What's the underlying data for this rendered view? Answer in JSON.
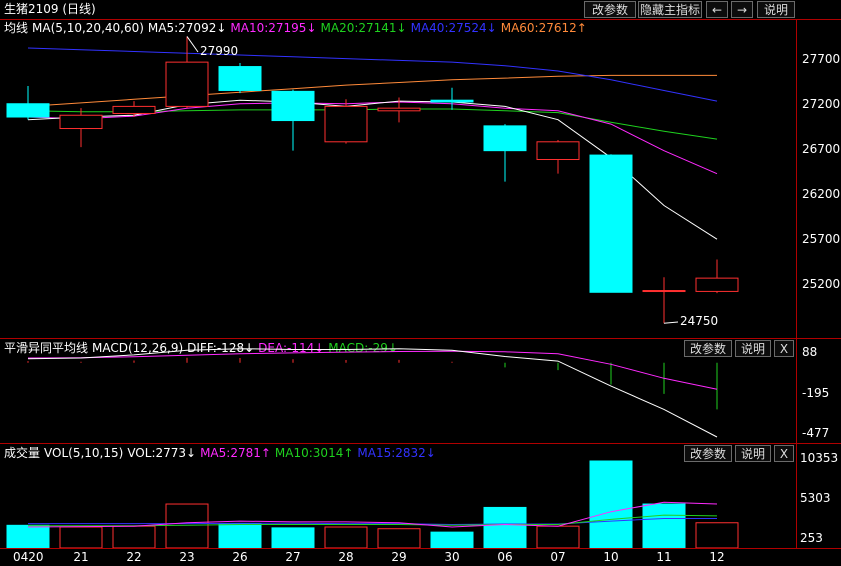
{
  "title": "生猪2109 (日线)",
  "toolbar": {
    "change_params": "改参数",
    "hide_indicator": "隐藏主指标",
    "left_arrow": "←",
    "right_arrow": "→",
    "help": "说明"
  },
  "ma_header": {
    "name": "均线",
    "ma": "MA(5,10,20,40,60)",
    "ma5": "MA5:27092↓",
    "ma10": "MA10:27195↓",
    "ma20": "MA20:27141↓",
    "ma40": "MA40:27524↓",
    "ma60": "MA60:27612↑"
  },
  "price_axis": [
    "27700",
    "27200",
    "26700",
    "26200",
    "25700",
    "25200"
  ],
  "annotations": {
    "high": "27990",
    "low": "24750"
  },
  "macd_header": {
    "name": "平滑异同平均线",
    "macd": "MACD(12,26,9)",
    "diff": "DIFF:-128↓",
    "dea": "DEA:-114↓",
    "value": "MACD:-29↓"
  },
  "macd_axis": [
    "88",
    "-195",
    "-477"
  ],
  "macd_buttons": {
    "change_params": "改参数",
    "help": "说明",
    "close": "X"
  },
  "vol_header": {
    "name": "成交量",
    "vol": "VOL(5,10,15)",
    "current": "VOL:2773↓",
    "ma5": "MA5:2781↑",
    "ma10": "MA10:3014↑",
    "ma15": "MA15:2832↓"
  },
  "vol_axis": [
    "10353",
    "5303",
    "253"
  ],
  "vol_buttons": {
    "change_params": "改参数",
    "help": "说明",
    "close": "X"
  },
  "dates": [
    "0420",
    "21",
    "22",
    "23",
    "26",
    "27",
    "28",
    "29",
    "30",
    "06",
    "07",
    "10",
    "11",
    "12"
  ],
  "colors": {
    "up": "#ff3030",
    "down": "#00ffff",
    "ma5": "#ffffff",
    "ma10": "#ff2aff",
    "ma20": "#1fd11f",
    "ma40": "#3232ff",
    "ma60": "#ff8a3a",
    "border": "#b00000"
  },
  "chart_data": {
    "type": "candlestick",
    "x": [
      "0420",
      "21",
      "22",
      "23",
      "26",
      "27",
      "28",
      "29",
      "30",
      "06",
      "07",
      "10",
      "11",
      "12"
    ],
    "candles": [
      {
        "open": 27230,
        "close": 27080,
        "high": 27430,
        "low": 27050
      },
      {
        "open": 26950,
        "close": 27100,
        "high": 27180,
        "low": 26740
      },
      {
        "open": 27120,
        "close": 27200,
        "high": 27260,
        "low": 27080
      },
      {
        "open": 27200,
        "close": 27700,
        "high": 27990,
        "low": 27180
      },
      {
        "open": 27650,
        "close": 27380,
        "high": 27690,
        "low": 27350
      },
      {
        "open": 27370,
        "close": 27040,
        "high": 27390,
        "low": 26700
      },
      {
        "open": 26800,
        "close": 27200,
        "high": 27280,
        "low": 26780
      },
      {
        "open": 27150,
        "close": 27180,
        "high": 27300,
        "low": 27020
      },
      {
        "open": 27270,
        "close": 27250,
        "high": 27410,
        "low": 27160
      },
      {
        "open": 26980,
        "close": 26700,
        "high": 27000,
        "low": 26350
      },
      {
        "open": 26600,
        "close": 26800,
        "high": 26820,
        "low": 26440
      },
      {
        "open": 26650,
        "close": 25100,
        "high": 26660,
        "low": 25100
      },
      {
        "open": 25120,
        "close": 25120,
        "high": 25270,
        "low": 24750
      },
      {
        "open": 25110,
        "close": 25260,
        "high": 25470,
        "low": 25090
      }
    ],
    "ma5": [
      27050,
      27080,
      27100,
      27220,
      27270,
      27250,
      27200,
      27260,
      27250,
      27200,
      27050,
      26620,
      26080,
      25700
    ],
    "ma10": [
      27080,
      27060,
      27090,
      27180,
      27230,
      27240,
      27230,
      27250,
      27230,
      27180,
      27150,
      27000,
      26700,
      26440
    ],
    "ma20": [
      27150,
      27140,
      27140,
      27150,
      27160,
      27160,
      27160,
      27170,
      27170,
      27150,
      27130,
      27020,
      26920,
      26830
    ],
    "ma40": [
      27860,
      27840,
      27820,
      27800,
      27780,
      27760,
      27740,
      27720,
      27700,
      27660,
      27600,
      27500,
      27380,
      27260
    ],
    "ma60": [
      27200,
      27240,
      27280,
      27320,
      27360,
      27400,
      27440,
      27470,
      27500,
      27520,
      27540,
      27550,
      27550,
      27550
    ],
    "price_ylim": [
      24900,
      27950
    ],
    "macd": {
      "diff": [
        25,
        30,
        50,
        80,
        90,
        85,
        85,
        90,
        80,
        40,
        10,
        -150,
        -300,
        -477
      ],
      "dea": [
        30,
        32,
        38,
        48,
        58,
        63,
        68,
        72,
        74,
        70,
        58,
        -10,
        -100,
        -170
      ],
      "bars": [
        10,
        6,
        14,
        32,
        30,
        22,
        17,
        18,
        6,
        -30,
        -48,
        -140,
        -200,
        -300
      ],
      "ylim": [
        -477,
        88
      ]
    },
    "volume": {
      "values": [
        2800,
        2600,
        2700,
        5300,
        3000,
        2500,
        2600,
        2400,
        2000,
        4900,
        2700,
        10353,
        5300,
        3100
      ],
      "up": [
        false,
        true,
        true,
        true,
        false,
        false,
        true,
        true,
        false,
        false,
        true,
        false,
        false,
        true
      ],
      "ma5": [
        2600,
        2650,
        2700,
        3100,
        3300,
        3200,
        3200,
        3100,
        2600,
        2900,
        2700,
        4400,
        5500,
        5300
      ],
      "ma10": [
        2750,
        2750,
        2760,
        2800,
        2900,
        2900,
        2900,
        2900,
        2800,
        2900,
        2900,
        3500,
        4000,
        3900
      ],
      "ma15": [
        3000,
        3000,
        3000,
        3000,
        3050,
        3050,
        3000,
        3000,
        2900,
        2950,
        2950,
        3300,
        3600,
        3600
      ],
      "ylim": [
        253,
        10353
      ]
    }
  }
}
